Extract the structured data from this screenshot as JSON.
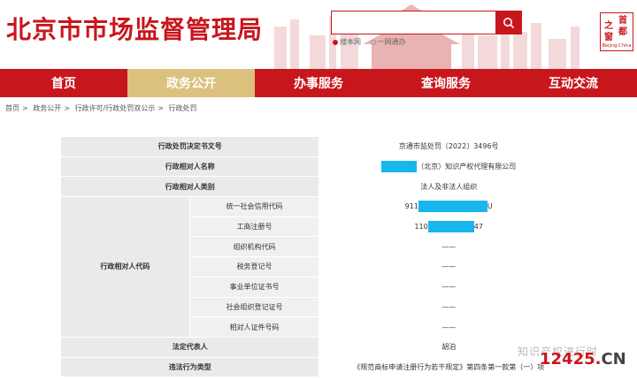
{
  "header": {
    "site_title": "北京市市场监督管理局",
    "search": {
      "placeholder": "",
      "options": [
        "搜本网",
        "一网通办"
      ],
      "selected": "搜本网"
    },
    "logo": {
      "chars": [
        "首",
        "都",
        "之",
        "窗"
      ],
      "subtitle": "Beijing-China"
    }
  },
  "nav": {
    "items": [
      "首页",
      "政务公开",
      "办事服务",
      "查询服务",
      "互动交流"
    ],
    "active": "政务公开"
  },
  "breadcrumb": [
    "首页",
    "政务公开",
    "行政许可/行政处罚双公示",
    "行政处罚"
  ],
  "table": {
    "doc_number_label": "行政处罚决定书文号",
    "doc_number_value": "京通市监处罚〔2022〕3496号",
    "party_name_label": "行政相对人名称",
    "party_name_value": "（北京）知识产权代理有限公司",
    "party_type_label": "行政相对人类别",
    "party_type_value": "法人及非法人组织",
    "party_code_label": "行政相对人代码",
    "codes": [
      {
        "label": "统一社会信用代码",
        "prefix": "911",
        "suffix": "U"
      },
      {
        "label": "工商注册号",
        "prefix": "110",
        "suffix": "47"
      },
      {
        "label": "组织机构代码",
        "value": "——"
      },
      {
        "label": "税务登记号",
        "value": "——"
      },
      {
        "label": "事业单位证书号",
        "value": "——"
      },
      {
        "label": "社会组织登记证号",
        "value": "——"
      },
      {
        "label": "相对人证件号码",
        "value": "——"
      }
    ],
    "legal_rep_label": "法定代表人",
    "legal_rep_value": "胡泊",
    "violation_label": "违法行为类型",
    "violation_value": "《规范商标申请注册行为若干规定》第四条第一款第（一）项"
  },
  "watermark": {
    "text": "知识产权进行时",
    "site": "12425.",
    "site_suffix": "CN"
  },
  "colors": {
    "brand_red": "#c8161d",
    "nav_active": "#dcc17e",
    "redaction": "#19b6ee"
  }
}
